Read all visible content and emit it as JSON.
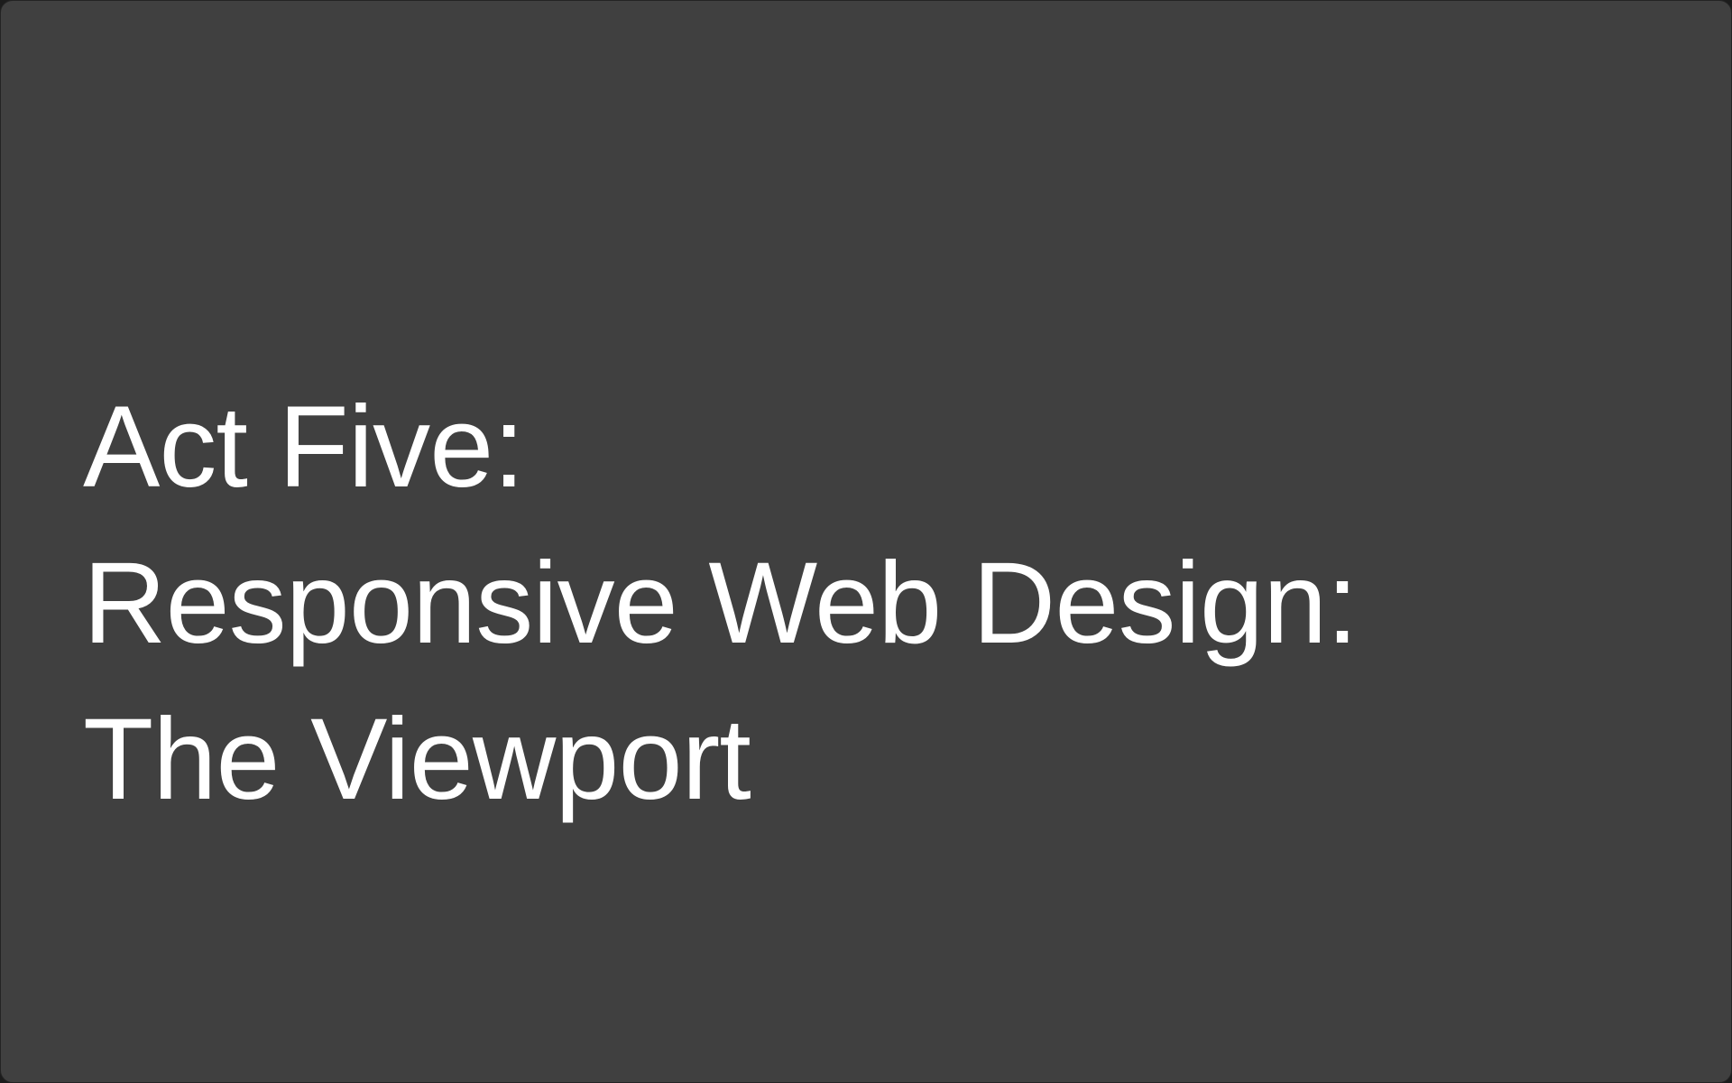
{
  "slide": {
    "title_lines": [
      "Act Five:",
      "Responsive Web Design:",
      "The Viewport"
    ],
    "colors": {
      "background": "#404040",
      "text": "#ffffff"
    }
  }
}
